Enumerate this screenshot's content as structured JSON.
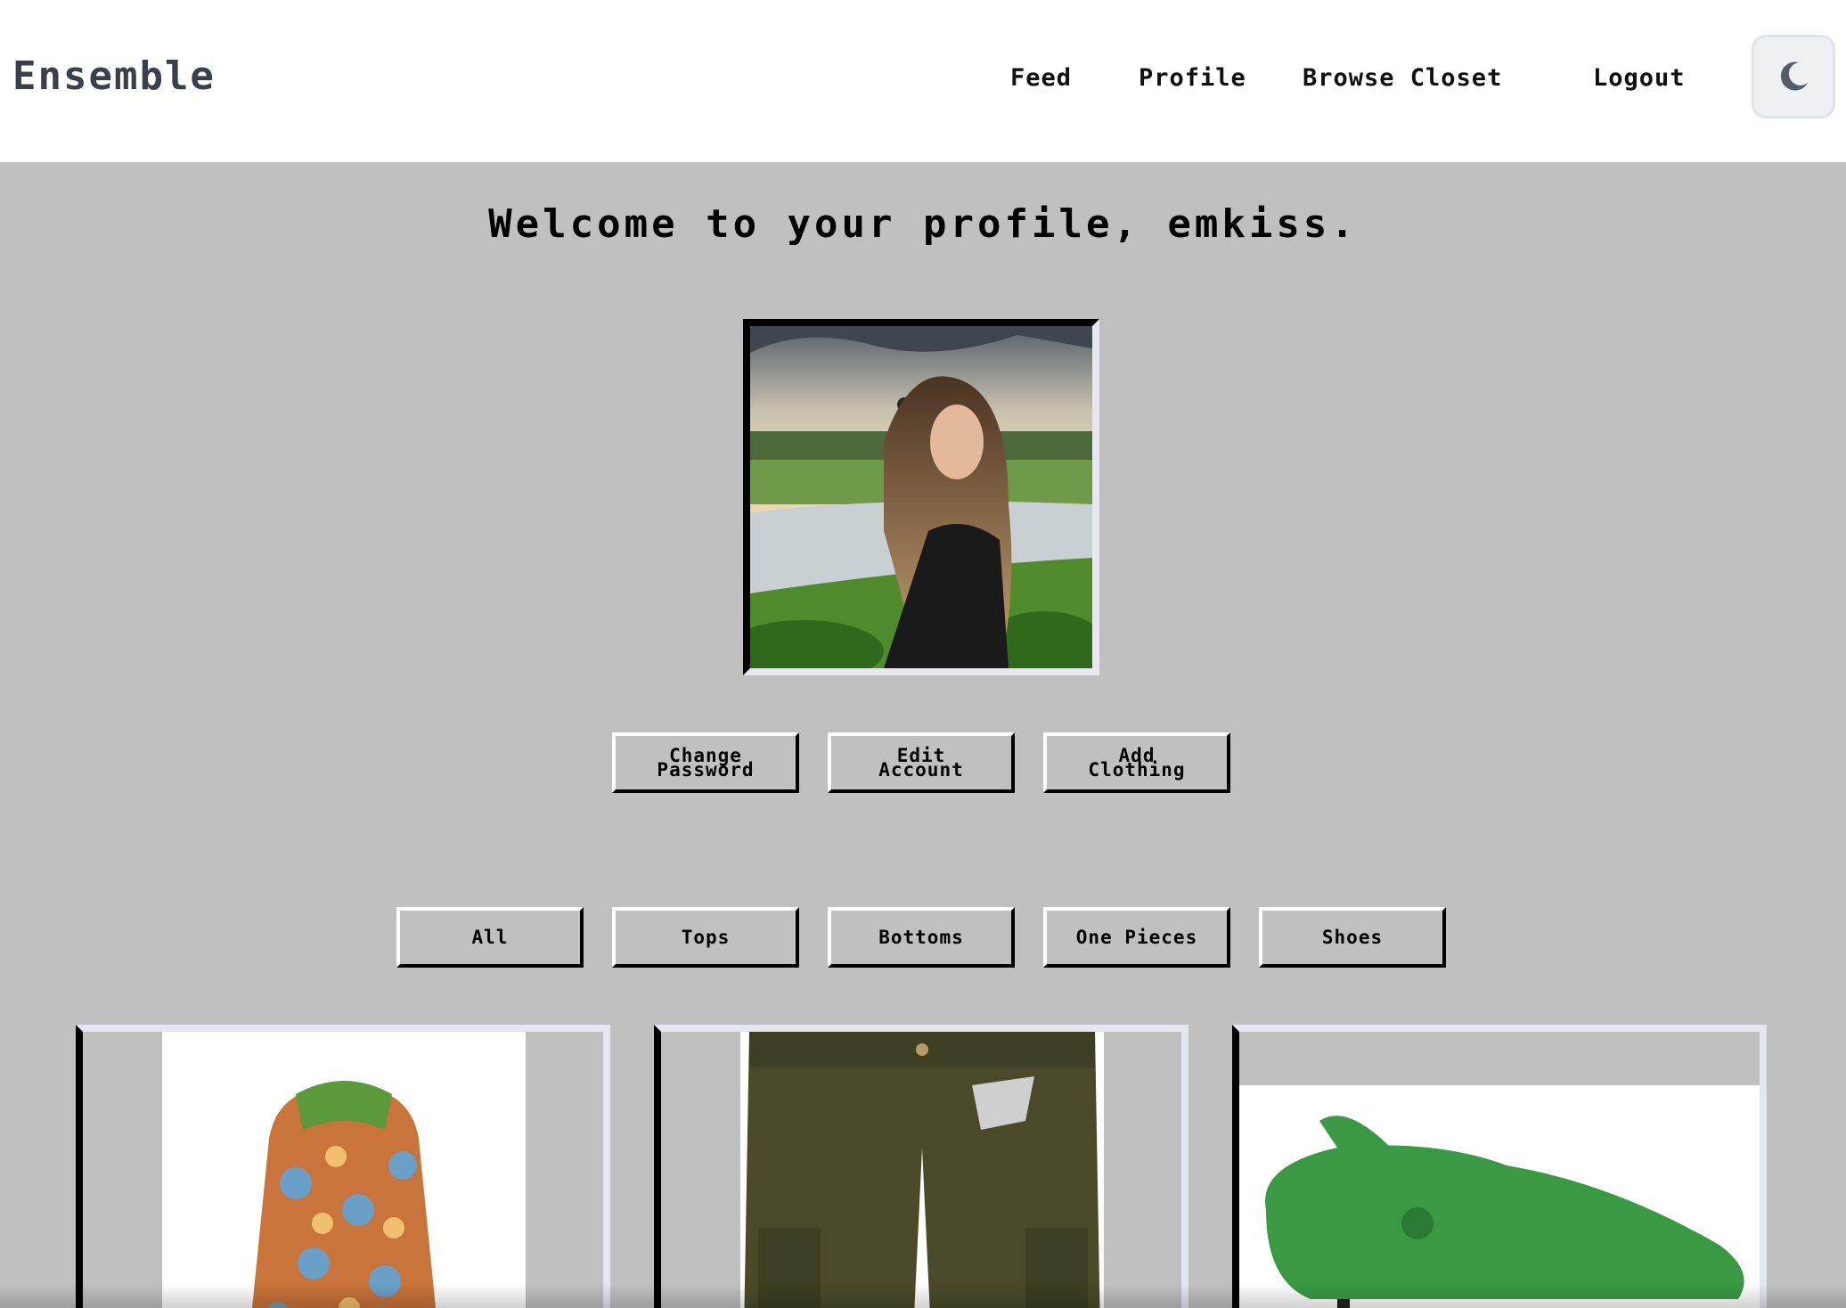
{
  "navbar": {
    "brand": "Ensemble",
    "links": [
      "Feed",
      "Profile",
      "Browse Closet",
      "Logout"
    ],
    "theme_toggle_icon": "moon-icon"
  },
  "main": {
    "welcome_text": "Welcome to your profile, emkiss.",
    "profile_photo_alt": "profile photo",
    "actions": [
      {
        "line1": "Change",
        "line2": "Password"
      },
      {
        "line1": "Edit",
        "line2": "Account"
      },
      {
        "line1": "Add",
        "line2": "Clothing"
      }
    ],
    "filters": [
      "All",
      "Tops",
      "Bottoms",
      "One Pieces",
      "Shoes"
    ],
    "clothing_items": [
      {
        "name": "patterned jacket",
        "kind": "top"
      },
      {
        "name": "cargo shorts",
        "kind": "bottom"
      },
      {
        "name": "green clog shoe",
        "kind": "shoes"
      }
    ]
  },
  "colors": {
    "page_bg": "#c0c0c0",
    "navbar_bg": "#ffffff",
    "brand_text": "#3a4049",
    "toggle_bg": "#eef0f3"
  }
}
